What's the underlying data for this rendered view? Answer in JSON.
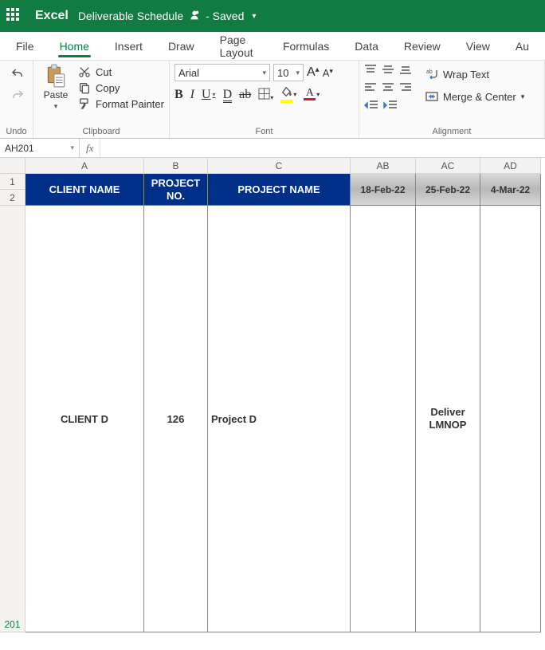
{
  "titlebar": {
    "app": "Excel",
    "doc": "Deliverable Schedule",
    "status": "- Saved"
  },
  "tabs": [
    "File",
    "Home",
    "Insert",
    "Draw",
    "Page Layout",
    "Formulas",
    "Data",
    "Review",
    "View",
    "Au"
  ],
  "active_tab": 1,
  "ribbon": {
    "undo_label": "Undo",
    "clipboard": {
      "paste": "Paste",
      "cut": "Cut",
      "copy": "Copy",
      "format_painter": "Format Painter",
      "label": "Clipboard"
    },
    "font": {
      "name": "Arial",
      "size": "10",
      "label": "Font"
    },
    "alignment": {
      "wrap": "Wrap Text",
      "merge": "Merge & Center",
      "label": "Alignment"
    }
  },
  "namebox": "AH201",
  "formula": "",
  "columns": {
    "A": "A",
    "B": "B",
    "C": "C",
    "AB": "AB",
    "AC": "AC",
    "AD": "AD"
  },
  "rows": {
    "r1": "1",
    "r2": "2",
    "r201": "201"
  },
  "headers": {
    "client_name": "CLIENT NAME",
    "project_no_l1": "PROJECT",
    "project_no_l2": "NO.",
    "project_name": "PROJECT NAME",
    "d1": "18-Feb-22",
    "d2": "25-Feb-22",
    "d3": "4-Mar-22"
  },
  "row_data": {
    "client": "CLIENT D",
    "no": "126",
    "project": "Project D",
    "ab": "",
    "ac_l1": "Deliver",
    "ac_l2": "LMNOP",
    "ad": ""
  }
}
